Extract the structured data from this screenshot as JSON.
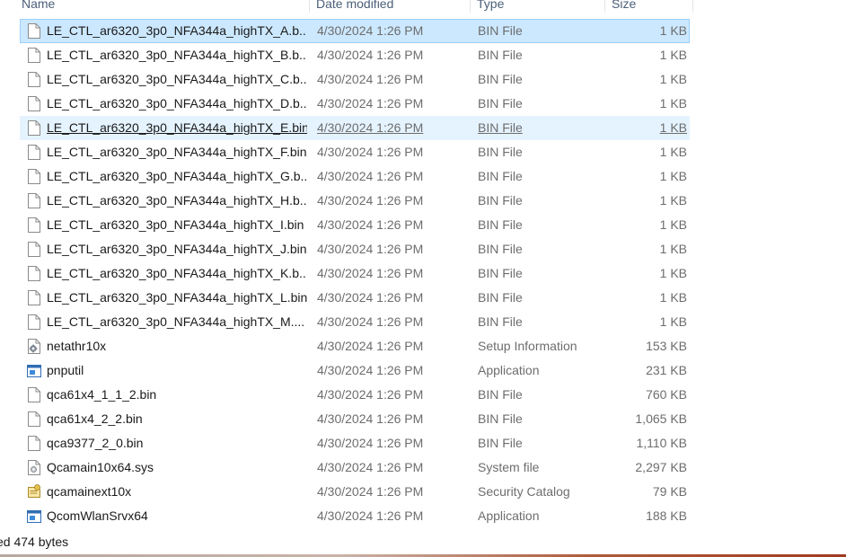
{
  "columns": {
    "name": "Name",
    "date": "Date modified",
    "type": "Type",
    "size": "Size"
  },
  "files": [
    {
      "name": "LE_CTL_ar6320_3p0_NFA344a_highTX_A.b...",
      "date": "4/30/2024 1:26 PM",
      "type": "BIN File",
      "size": "1 KB",
      "icon": "blank-file-icon",
      "state": "selected"
    },
    {
      "name": "LE_CTL_ar6320_3p0_NFA344a_highTX_B.b...",
      "date": "4/30/2024 1:26 PM",
      "type": "BIN File",
      "size": "1 KB",
      "icon": "blank-file-icon",
      "state": ""
    },
    {
      "name": "LE_CTL_ar6320_3p0_NFA344a_highTX_C.b...",
      "date": "4/30/2024 1:26 PM",
      "type": "BIN File",
      "size": "1 KB",
      "icon": "blank-file-icon",
      "state": ""
    },
    {
      "name": "LE_CTL_ar6320_3p0_NFA344a_highTX_D.b...",
      "date": "4/30/2024 1:26 PM",
      "type": "BIN File",
      "size": "1 KB",
      "icon": "blank-file-icon",
      "state": ""
    },
    {
      "name": "LE_CTL_ar6320_3p0_NFA344a_highTX_E.bin",
      "date": "4/30/2024 1:26 PM",
      "type": "BIN File",
      "size": "1 KB",
      "icon": "blank-file-icon",
      "state": "hover"
    },
    {
      "name": "LE_CTL_ar6320_3p0_NFA344a_highTX_F.bin",
      "date": "4/30/2024 1:26 PM",
      "type": "BIN File",
      "size": "1 KB",
      "icon": "blank-file-icon",
      "state": ""
    },
    {
      "name": "LE_CTL_ar6320_3p0_NFA344a_highTX_G.b...",
      "date": "4/30/2024 1:26 PM",
      "type": "BIN File",
      "size": "1 KB",
      "icon": "blank-file-icon",
      "state": ""
    },
    {
      "name": "LE_CTL_ar6320_3p0_NFA344a_highTX_H.b...",
      "date": "4/30/2024 1:26 PM",
      "type": "BIN File",
      "size": "1 KB",
      "icon": "blank-file-icon",
      "state": ""
    },
    {
      "name": "LE_CTL_ar6320_3p0_NFA344a_highTX_I.bin",
      "date": "4/30/2024 1:26 PM",
      "type": "BIN File",
      "size": "1 KB",
      "icon": "blank-file-icon",
      "state": ""
    },
    {
      "name": "LE_CTL_ar6320_3p0_NFA344a_highTX_J.bin",
      "date": "4/30/2024 1:26 PM",
      "type": "BIN File",
      "size": "1 KB",
      "icon": "blank-file-icon",
      "state": ""
    },
    {
      "name": "LE_CTL_ar6320_3p0_NFA344a_highTX_K.b...",
      "date": "4/30/2024 1:26 PM",
      "type": "BIN File",
      "size": "1 KB",
      "icon": "blank-file-icon",
      "state": ""
    },
    {
      "name": "LE_CTL_ar6320_3p0_NFA344a_highTX_L.bin",
      "date": "4/30/2024 1:26 PM",
      "type": "BIN File",
      "size": "1 KB",
      "icon": "blank-file-icon",
      "state": ""
    },
    {
      "name": "LE_CTL_ar6320_3p0_NFA344a_highTX_M....",
      "date": "4/30/2024 1:26 PM",
      "type": "BIN File",
      "size": "1 KB",
      "icon": "blank-file-icon",
      "state": ""
    },
    {
      "name": "netathr10x",
      "date": "4/30/2024 1:26 PM",
      "type": "Setup Information",
      "size": "153 KB",
      "icon": "setup-info-icon",
      "state": ""
    },
    {
      "name": "pnputil",
      "date": "4/30/2024 1:26 PM",
      "type": "Application",
      "size": "231 KB",
      "icon": "application-icon",
      "state": ""
    },
    {
      "name": "qca61x4_1_1_2.bin",
      "date": "4/30/2024 1:26 PM",
      "type": "BIN File",
      "size": "760 KB",
      "icon": "blank-file-icon",
      "state": ""
    },
    {
      "name": "qca61x4_2_2.bin",
      "date": "4/30/2024 1:26 PM",
      "type": "BIN File",
      "size": "1,065 KB",
      "icon": "blank-file-icon",
      "state": ""
    },
    {
      "name": "qca9377_2_0.bin",
      "date": "4/30/2024 1:26 PM",
      "type": "BIN File",
      "size": "1,110 KB",
      "icon": "blank-file-icon",
      "state": ""
    },
    {
      "name": "Qcamain10x64.sys",
      "date": "4/30/2024 1:26 PM",
      "type": "System file",
      "size": "2,297 KB",
      "icon": "system-file-icon",
      "state": ""
    },
    {
      "name": "qcamainext10x",
      "date": "4/30/2024 1:26 PM",
      "type": "Security Catalog",
      "size": "79 KB",
      "icon": "security-catalog-icon",
      "state": ""
    },
    {
      "name": "QcomWlanSrvx64",
      "date": "4/30/2024 1:26 PM",
      "type": "Application",
      "size": "188 KB",
      "icon": "application-icon",
      "state": ""
    }
  ],
  "status": {
    "text": "ed  474 bytes"
  },
  "colors": {
    "selected_bg": "#cce8ff",
    "selected_border": "#99d1ff",
    "hover_bg": "#e5f3ff",
    "header_text": "#4c607a",
    "secondary_text": "#6d6d6d"
  }
}
